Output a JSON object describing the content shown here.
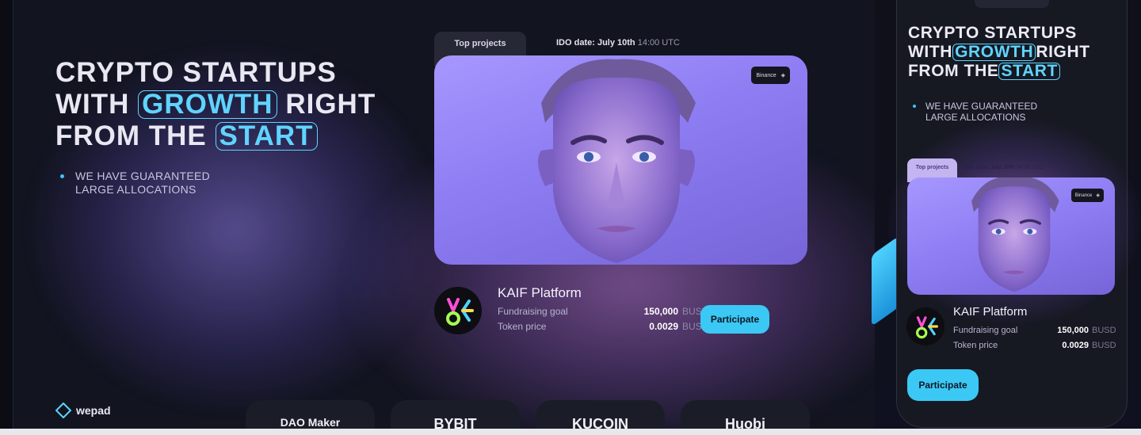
{
  "hero": {
    "line1": "CRYPTO STARTUPS",
    "line2_pre": "WITH",
    "line2_highlight": "GROWTH",
    "line2_post": "RIGHT",
    "line3_pre": "FROM THE",
    "line3_highlight": "START",
    "bullet": "WE HAVE GUARANTEED LARGE ALLOCATIONS",
    "bullet_line1": "WE HAVE GUARANTEED",
    "bullet_line2": "LARGE ALLOCATIONS"
  },
  "card": {
    "tab_label": "Top projects",
    "ido_prefix": "IDO date: July 10th",
    "ido_time": "14:00 UTC",
    "exchange": "Binance"
  },
  "project": {
    "name": "KAIF Platform",
    "stats": [
      {
        "label": "Fundraising goal",
        "value": "150,000",
        "unit": "BUSD"
      },
      {
        "label": "Token price",
        "value": "0.0029",
        "unit": "BUSD"
      }
    ],
    "cta": "Participate"
  },
  "footer": {
    "brand": "wepad",
    "partners": [
      "DAO Maker",
      "BYBIT",
      "KUCOIN",
      "Huobi"
    ]
  },
  "colors": {
    "accent": "#3cc8f4",
    "highlight": "#5fd4ff",
    "background": "#121420",
    "card_image": "#9a89f8"
  },
  "icons": [
    "wepad-logo-icon",
    "binance-diamond-icon",
    "kaif-logo-icon"
  ]
}
